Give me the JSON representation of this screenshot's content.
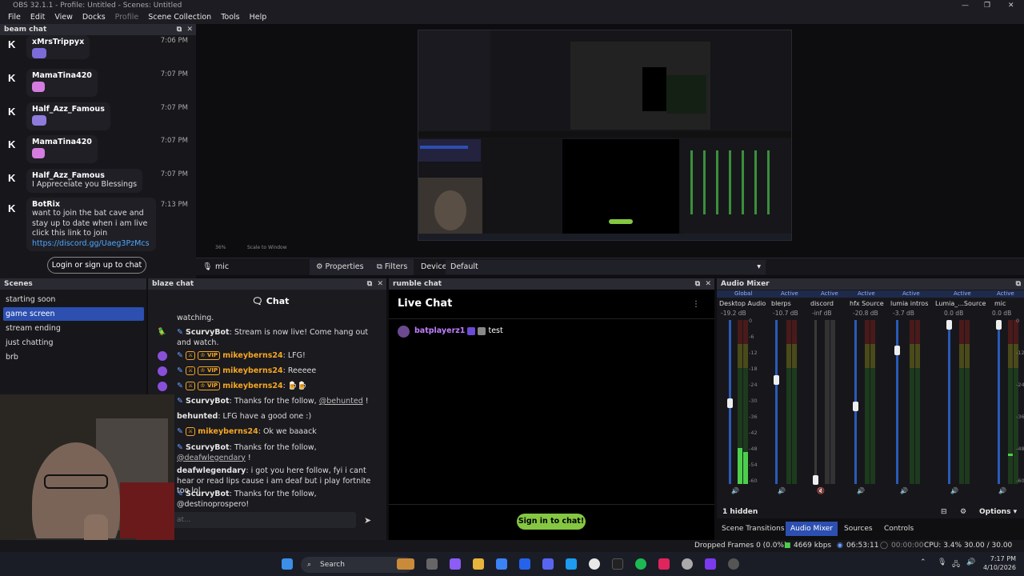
{
  "window": {
    "title": "OBS 32.1.1 - Profile: Untitled - Scenes: Untitled"
  },
  "menu": [
    "File",
    "Edit",
    "View",
    "Docks",
    "Profile",
    "Scene Collection",
    "Tools",
    "Help"
  ],
  "beam_chat": {
    "title": "beam chat",
    "messages": [
      {
        "user": "xMrsTrippyx",
        "time": "7:06 PM",
        "emote_color": "#7b6cd9"
      },
      {
        "user": "MamaTina420",
        "time": "7:07 PM",
        "emote_color": "#d47ce0"
      },
      {
        "user": "Half_Azz_Famous",
        "time": "7:07 PM",
        "emote_color": "#8f7bdc"
      },
      {
        "user": "MamaTina420",
        "time": "7:07 PM",
        "emote_color": "#d47ce0"
      },
      {
        "user": "Half_Azz_Famous",
        "time": "7:07 PM",
        "text": "I Appreceiate you Blessings"
      },
      {
        "user": "BotRix",
        "time": "7:13 PM",
        "text": "want to join the bat cave and stay up to date when i am live click this link to join ",
        "link": "https://discord.gg/Uaeg3PzMcs"
      }
    ],
    "login_button": "Login or sign up to chat"
  },
  "preview": {
    "zoom": "36%",
    "scale_mode": "Scale to Window"
  },
  "properties_bar": {
    "source": "mic",
    "properties": "Properties",
    "filters": "Filters",
    "device_label": "Device",
    "device_value": "Default"
  },
  "scenes": {
    "title": "Scenes",
    "items": [
      "starting soon",
      "game screen",
      "stream ending",
      "just chatting",
      "brb"
    ],
    "active_index": 1
  },
  "blaze_chat": {
    "title": "blaze chat",
    "header": "Chat",
    "lines": [
      {
        "text": "watching."
      },
      {
        "name": "ScurvyBot",
        "text": " Stream is now live! Come hang out and watch."
      },
      {
        "badges": true,
        "user": "mikeyberns24",
        "text": " LFG!"
      },
      {
        "badges": true,
        "user": "mikeyberns24",
        "text": " Reeeee"
      },
      {
        "badges": true,
        "user": "mikeyberns24",
        "text": " 🍺🍺"
      },
      {
        "name": "ScurvyBot",
        "text": " Thanks for the follow, ",
        "mention": "@behunted",
        "tail": " !"
      },
      {
        "plain_name": "behunted",
        "text": " LFG have a good one :)"
      },
      {
        "badge_only": true,
        "user": "mikeyberns24",
        "text": " Ok we baaack"
      },
      {
        "name": "ScurvyBot",
        "text": " Thanks for the follow, ",
        "mention": "@deafwlegendary",
        "tail": " !"
      },
      {
        "plain_name": "deafwlegendary",
        "text": " i got you here follow, fyi i cant hear or read lips cause i am deaf but i play fortnite too lol"
      },
      {
        "name": "ScurvyBot",
        "text": " Thanks for the follow, @destinoprospero!"
      }
    ],
    "badge_vip": "VIP",
    "input_placeholder": "at..."
  },
  "rumble_chat": {
    "title": "rumble chat",
    "heading": "Live Chat",
    "messages": [
      {
        "user": "batplayerz1",
        "text": "test"
      }
    ],
    "signin_button": "Sign in to chat!"
  },
  "audio_mixer": {
    "title": "Audio Mixer",
    "global_label": "Global",
    "active_label": "Active",
    "channels": [
      {
        "name": "Desktop Audio",
        "db": "-19.2 dB"
      },
      {
        "name": "blerps",
        "db": "-10.7 dB"
      },
      {
        "name": "discord",
        "db": "-inf dB"
      },
      {
        "name": "hfx Source",
        "db": "-20.8 dB"
      },
      {
        "name": "lumia intros",
        "db": "-3.7 dB"
      },
      {
        "name": "Lumia_...Source",
        "db": "0.0 dB"
      },
      {
        "name": "mic",
        "db": "0.0 dB"
      }
    ],
    "scale": [
      "0",
      "-6",
      "-12",
      "-18",
      "-24",
      "-30",
      "-36",
      "-42",
      "-48",
      "-54",
      "-60"
    ],
    "hidden_count": "1 hidden",
    "options": "Options"
  },
  "bottom_tabs": [
    "Scene Transitions",
    "Audio Mixer",
    "Sources",
    "Controls"
  ],
  "active_bottom_tab": "Audio Mixer",
  "status": {
    "dropped": "Dropped Frames 0 (0.0%)",
    "bitrate": "4669 kbps",
    "stream_time": "06:53:11",
    "rec_time": "00:00:00",
    "cpu": "CPU: 3.4%",
    "fps": "30.00 / 30.00 FPS"
  },
  "taskbar": {
    "search": "Search",
    "time": "7:17 PM",
    "date": "4/10/2026"
  },
  "colors": {
    "accent": "#2c4fb0",
    "rumble_green": "#85c742",
    "blaze_orange": "#f5a623"
  }
}
